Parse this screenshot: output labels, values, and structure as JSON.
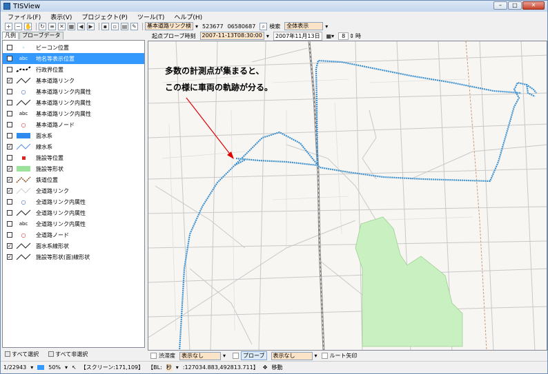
{
  "window": {
    "title": "TISView"
  },
  "menu": [
    "ファイル(F)",
    "表示(V)",
    "プロジェクト(P)",
    "ツール(T)",
    "ヘルプ(H)"
  ],
  "toolbar": {
    "layer_combo": "基本道路リンク検",
    "value1": "523677",
    "value2": "06580687",
    "search_label": "検索",
    "view_combo": "全体表示"
  },
  "map_header": {
    "start_label": "起点プローブ時刻",
    "start_value": "2007-11-13T08:30:00",
    "date_value": "2007年11月13日",
    "hour_value": "8",
    "hour_unit": "時"
  },
  "left_tabs": [
    "凡例",
    "プローブデータ"
  ],
  "legend": [
    {
      "label": "ビーコン位置",
      "checked": false,
      "symbol": "circle-cyan",
      "selected": false
    },
    {
      "label": "地名等表示位置",
      "checked": false,
      "symbol": "abc",
      "selected": true
    },
    {
      "label": "行政界位置",
      "checked": false,
      "symbol": "dash-black",
      "selected": false
    },
    {
      "label": "基本道路リンク",
      "checked": true,
      "symbol": "line-black",
      "selected": false
    },
    {
      "label": "基本道路リンク内属性",
      "checked": false,
      "symbol": "circle-blue",
      "selected": false
    },
    {
      "label": "基本道路リンク内属性",
      "checked": false,
      "symbol": "line-black",
      "selected": false
    },
    {
      "label": "基本道路リンク内属性",
      "checked": false,
      "symbol": "abc",
      "selected": false
    },
    {
      "label": "基本道路ノード",
      "checked": false,
      "symbol": "circle-red",
      "selected": false
    },
    {
      "label": "面水系",
      "checked": false,
      "symbol": "rect-blue",
      "selected": false
    },
    {
      "label": "線水系",
      "checked": true,
      "symbol": "line-blue",
      "selected": false
    },
    {
      "label": "施設等位置",
      "checked": false,
      "symbol": "square-red",
      "selected": false
    },
    {
      "label": "施設等形状",
      "checked": true,
      "symbol": "rect-green",
      "selected": false
    },
    {
      "label": "鉄道位置",
      "checked": true,
      "symbol": "rail-brown",
      "selected": false
    },
    {
      "label": "全道路リンク",
      "checked": true,
      "symbol": "line-gray",
      "selected": false
    },
    {
      "label": "全道路リンク内属性",
      "checked": false,
      "symbol": "circle-blue",
      "selected": false
    },
    {
      "label": "全道路リンク内属性",
      "checked": false,
      "symbol": "line-black",
      "selected": false
    },
    {
      "label": "全道路リンク内属性",
      "checked": false,
      "symbol": "abc",
      "selected": false
    },
    {
      "label": "全道路ノード",
      "checked": false,
      "symbol": "circle-red",
      "selected": false
    },
    {
      "label": "面水系線形状",
      "checked": true,
      "symbol": "line-black",
      "selected": false
    },
    {
      "label": "施設等形状(面)線形状",
      "checked": true,
      "symbol": "line-black",
      "selected": false
    }
  ],
  "left_bottom": {
    "select_all": "すべて選択",
    "deselect_all": "すべて非選択"
  },
  "annotation": {
    "line1": "多数の計測点が集まると、",
    "line2": "この様に車両の軌跡が分る。"
  },
  "map_bottom": {
    "congestion_label": "渋滞度",
    "congestion_value": "表示なし",
    "probe_label": "プローブ",
    "probe_value": "表示なし",
    "route_label": "ルート矢印"
  },
  "status": {
    "scale": "1/22943",
    "zoom": "50%",
    "screen": "【スクリーン:171,109】",
    "bl_label": "【BL:",
    "bl_unit": "秒",
    "bl_value": ":127034.883,492813.711】",
    "move": "移動"
  },
  "colors": {
    "probe": "#3a8fd0",
    "park": "#c9f0c0",
    "arrow": "#e00000",
    "selected": "#3399ff"
  }
}
